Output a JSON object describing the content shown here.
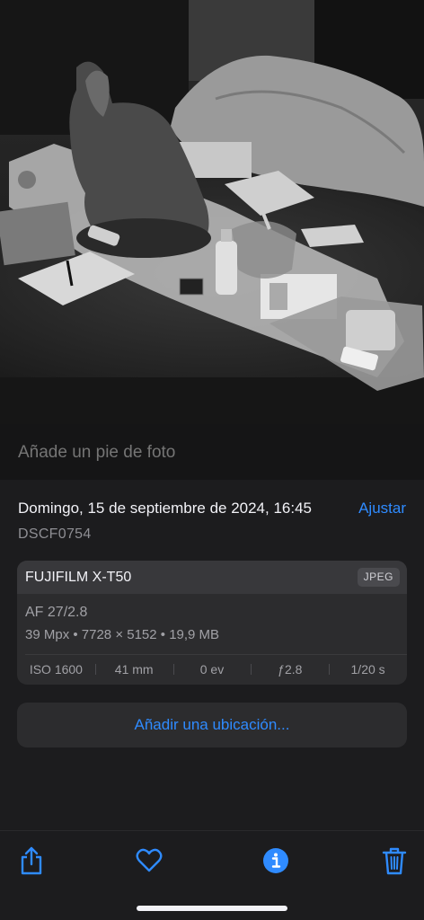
{
  "photo": {
    "description_icon": "photo-viewer"
  },
  "caption": {
    "placeholder": "Añade un pie de foto"
  },
  "metadata": {
    "date": "Domingo, 15 de septiembre de 2024, 16:45",
    "adjust_label": "Ajustar",
    "filename": "DSCF0754"
  },
  "camera_card": {
    "camera": "FUJIFILM X-T50",
    "format": "JPEG",
    "lens": "AF 27/2.8",
    "specs": "39 Mpx  •  7728 × 5152  •  19,9 MB",
    "exif": [
      "ISO 1600",
      "41 mm",
      "0 ev",
      "ƒ2.8",
      "1/20 s"
    ]
  },
  "location": {
    "label": "Añadir una ubicación..."
  },
  "toolbar": {
    "items": [
      "share-icon",
      "heart-icon",
      "info-icon",
      "trash-icon"
    ],
    "accent": "#2f8bff"
  }
}
